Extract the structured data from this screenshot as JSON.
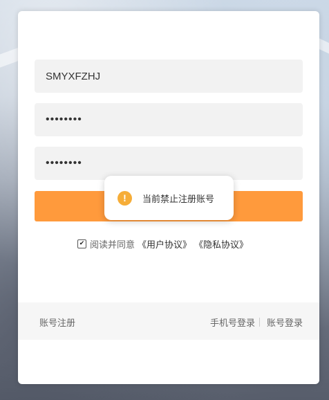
{
  "form": {
    "username_value": "SMYXFZHJ",
    "password_value": "12345678",
    "confirm_password_value": "12345678",
    "login_button_label": ""
  },
  "agreement": {
    "checked": true,
    "check_mark": "✔",
    "text": "阅读并同意",
    "user_agreement": "《用户协议》",
    "privacy_agreement": "《隐私协议》"
  },
  "footer": {
    "register": "账号注册",
    "phone_login": "手机号登录",
    "account_login": "账号登录"
  },
  "toast": {
    "icon": "!",
    "icon_name": "warning-icon",
    "message": "当前禁止注册账号"
  },
  "colors": {
    "accent": "#ff9a3c",
    "warning": "#f6ad38"
  }
}
